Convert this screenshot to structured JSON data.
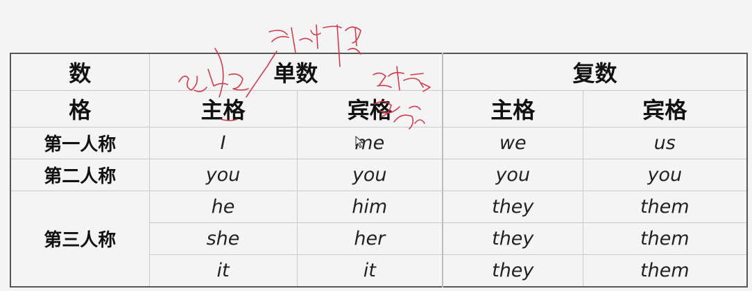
{
  "header": {
    "number": "数",
    "case": "格",
    "singular": "单数",
    "plural": "复数",
    "nominative_1": "主格",
    "objective_1": "宾格",
    "nominative_2": "主格",
    "objective_2": "宾格"
  },
  "rows": {
    "first_person": {
      "label": "第一人称",
      "cells": [
        "I",
        "me",
        "we",
        "us"
      ]
    },
    "second_person": {
      "label": "第二人称",
      "cells": [
        "you",
        "you",
        "you",
        "you"
      ]
    },
    "third_person": {
      "label": "第三人称",
      "lines": [
        [
          "he",
          "him",
          "they",
          "them"
        ],
        [
          "she",
          "her",
          "they",
          "them"
        ],
        [
          "it",
          "it",
          "they",
          "them"
        ]
      ]
    }
  },
  "colors": {
    "annotation": "#d23a4b",
    "grid": "#c9c9c9",
    "border": "#555555"
  }
}
